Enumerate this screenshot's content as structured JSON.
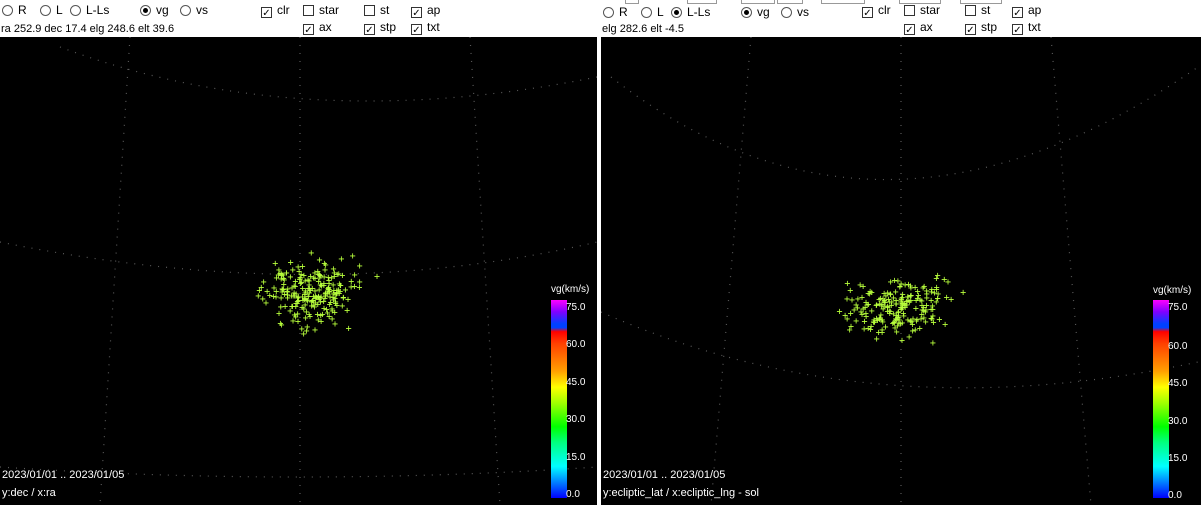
{
  "left": {
    "options_row1": [
      "R",
      "L",
      "L-Ls",
      "vg",
      "vs",
      "clr",
      "star",
      "st",
      "ap"
    ],
    "options_row2": [
      "ax",
      "stp",
      "txt"
    ],
    "info": "ra 252.9 dec 17.4 elg 248.6 elt 39.6",
    "date_range": "2023/01/01 .. 2023/01/05",
    "axes_label": "y:dec / x:ra",
    "selected": {
      "mode": "vg",
      "clr": true,
      "star": false,
      "st": false,
      "ap": true,
      "ax": true,
      "stp": true,
      "txt": true
    }
  },
  "right": {
    "options_row1": [
      "R",
      "L",
      "L-Ls",
      "vg",
      "vs",
      "clr",
      "star",
      "st",
      "ap"
    ],
    "options_row2": [
      "ax",
      "stp",
      "txt"
    ],
    "info": "elg 282.6 elt -4.5",
    "date_range": "2023/01/01 .. 2023/01/05",
    "axes_label": "y:ecliptic_lat / x:ecliptic_lng - sol",
    "selected": {
      "projection": "L-Ls",
      "mode": "vg",
      "clr": true,
      "star": false,
      "st": false,
      "ap": true,
      "ax": true,
      "stp": true,
      "txt": true
    }
  },
  "colorbar": {
    "title": "vg(km/s)",
    "ticks": [
      "75.0",
      "60.0",
      "45.0",
      "30.0",
      "15.0",
      "0.0"
    ],
    "colors": {
      "high": "#ff00ff",
      "mid": "#ffff00",
      "low": "#0000ff"
    }
  },
  "marker_color": "#b8ff3c"
}
